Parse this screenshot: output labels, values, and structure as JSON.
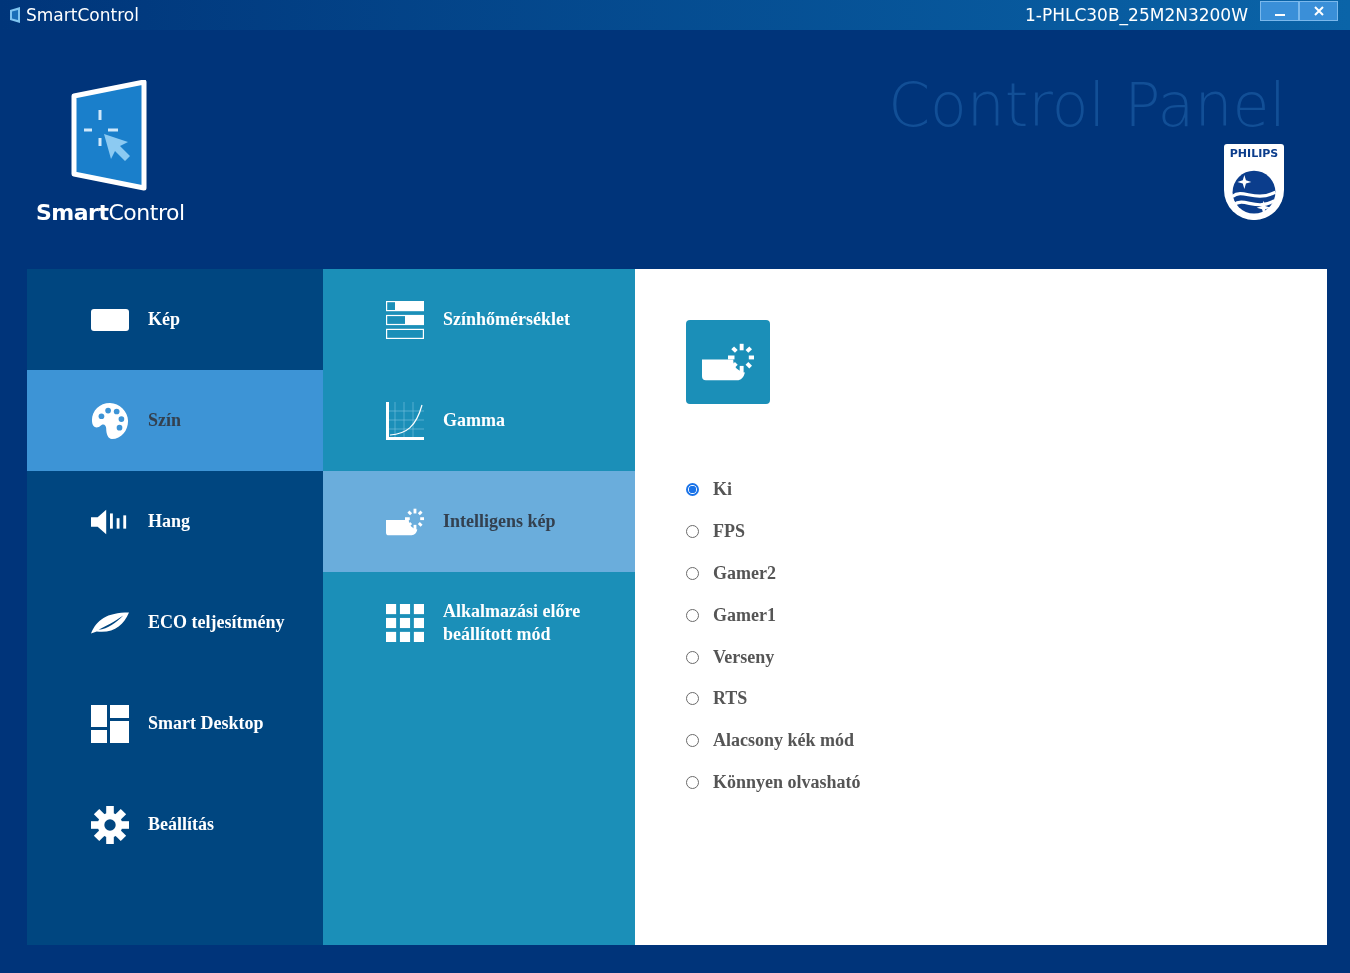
{
  "window": {
    "title": "SmartControl",
    "device": "1-PHLC30B_25M2N3200W"
  },
  "header": {
    "logo_text": "**Smart**Control",
    "title": "Control Panel",
    "brand": "PHILIPS"
  },
  "sidebar": {
    "items": [
      {
        "label": "Kép",
        "kind": "display",
        "selected": false
      },
      {
        "label": "Szín",
        "kind": "palette",
        "selected": true
      },
      {
        "label": "Hang",
        "kind": "speaker",
        "selected": false
      },
      {
        "label": "ECO teljesítmény",
        "kind": "leaf",
        "selected": false
      },
      {
        "label": "Smart Desktop",
        "kind": "desktop",
        "selected": false
      },
      {
        "label": "Beállítás",
        "kind": "gear",
        "selected": false
      }
    ]
  },
  "submenu": {
    "items": [
      {
        "label": "Színhőmérséklet",
        "kind": "bars",
        "selected": false
      },
      {
        "label": "Gamma",
        "kind": "curve",
        "selected": false
      },
      {
        "label": "Intelligens kép",
        "kind": "smartimage",
        "selected": true
      },
      {
        "label": "Alkalmazási előre beállított mód",
        "kind": "grid",
        "selected": false
      }
    ]
  },
  "content": {
    "options": [
      {
        "label": "Ki",
        "selected": true
      },
      {
        "label": "FPS",
        "selected": false
      },
      {
        "label": "Gamer2",
        "selected": false
      },
      {
        "label": "Gamer1",
        "selected": false
      },
      {
        "label": "Verseny",
        "selected": false
      },
      {
        "label": "RTS",
        "selected": false
      },
      {
        "label": "Alacsony kék mód",
        "selected": false
      },
      {
        "label": "Könnyen olvasható",
        "selected": false
      }
    ]
  }
}
